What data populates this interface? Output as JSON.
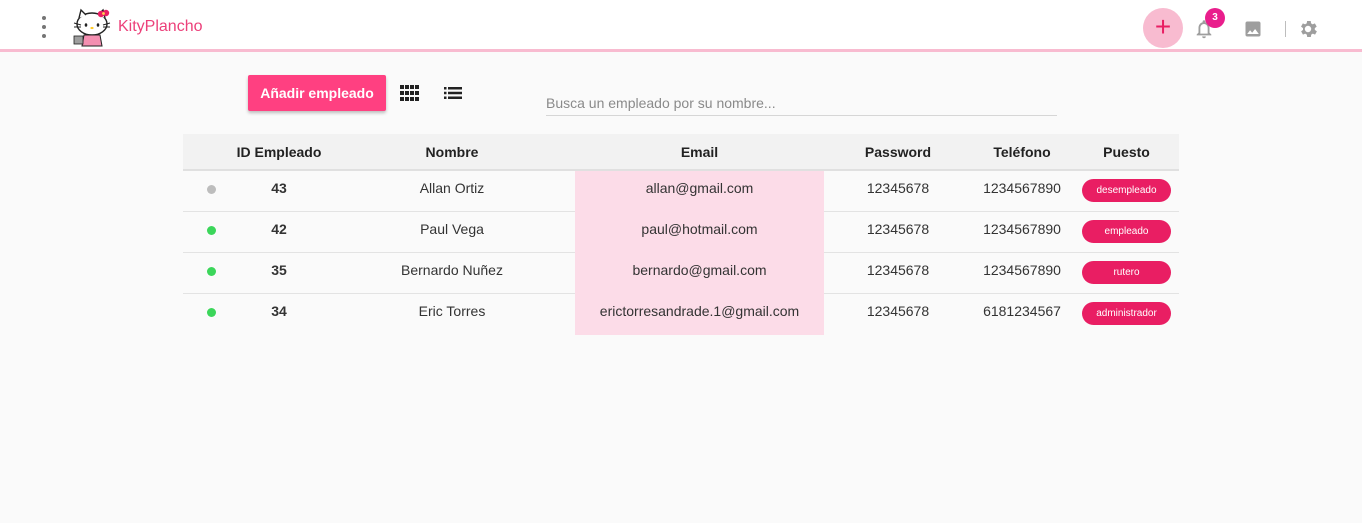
{
  "app": {
    "title": "KityPlancho"
  },
  "header": {
    "icons": [
      "more-vert-icon",
      "hello-kitty-logo",
      "add-icon",
      "bell-icon",
      "image-icon",
      "gear-icon"
    ],
    "notification_count": "3",
    "accent": "#e91e63"
  },
  "toolbar": {
    "add_button": "Añadir empleado",
    "grid_view": "grid-view-icon",
    "list_view": "list-view-icon"
  },
  "search": {
    "placeholder": "Busca un empleado por su nombre...",
    "value": ""
  },
  "table": {
    "columns": [
      "ID Empleado",
      "Nombre",
      "Email",
      "Password",
      "Teléfono",
      "Puesto"
    ],
    "rows": [
      {
        "status": "inactive",
        "status_color": "#bdbdbd",
        "id": "43",
        "nombre": "Allan Ortiz",
        "email": "allan@gmail.com",
        "password": "12345678",
        "telefono": "1234567890",
        "puesto": "desempleado"
      },
      {
        "status": "active",
        "status_color": "#3bd65a",
        "id": "42",
        "nombre": "Paul Vega",
        "email": "paul@hotmail.com",
        "password": "12345678",
        "telefono": "1234567890",
        "puesto": "empleado"
      },
      {
        "status": "active",
        "status_color": "#3bd65a",
        "id": "35",
        "nombre": "Bernardo Nuñez",
        "email": "bernardo@gmail.com",
        "password": "12345678",
        "telefono": "1234567890",
        "puesto": "rutero"
      },
      {
        "status": "active",
        "status_color": "#3bd65a",
        "id": "34",
        "nombre": "Eric Torres",
        "email": "erictorresandrade.1@gmail.com",
        "password": "12345678",
        "telefono": "6181234567",
        "puesto": "administrador"
      }
    ]
  }
}
